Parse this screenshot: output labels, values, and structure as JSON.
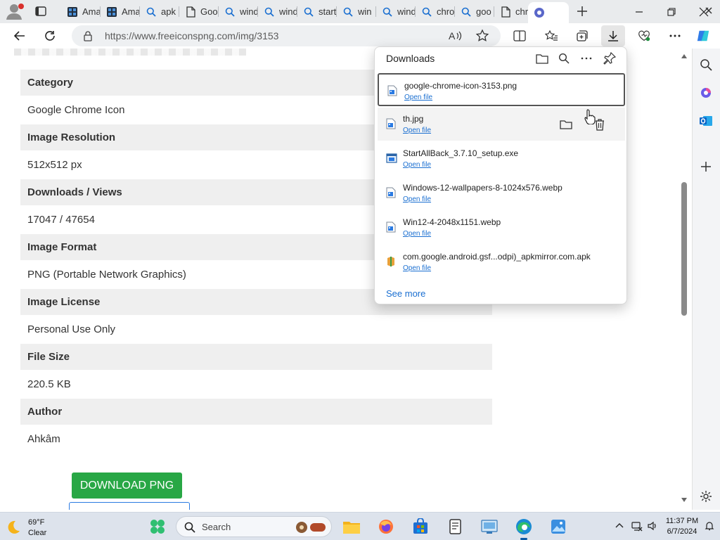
{
  "tabs": [
    {
      "label": "Ama",
      "icon": "amazon-favicon"
    },
    {
      "label": "Ama",
      "icon": "amazon-favicon"
    },
    {
      "label": "apk",
      "icon": "search-icon"
    },
    {
      "label": "Goo",
      "icon": "page-icon"
    },
    {
      "label": "wind",
      "icon": "search-icon"
    },
    {
      "label": "wind",
      "icon": "search-icon"
    },
    {
      "label": "start",
      "icon": "search-icon"
    },
    {
      "label": "win",
      "icon": "search-icon"
    },
    {
      "label": "wind",
      "icon": "search-icon"
    },
    {
      "label": "chro",
      "icon": "search-icon"
    },
    {
      "label": "goo",
      "icon": "search-icon"
    },
    {
      "label": "chro",
      "icon": "page-icon"
    }
  ],
  "address": {
    "url": "https://www.freeiconspng.com/img/3153"
  },
  "details": [
    {
      "heading": "Category",
      "value": "Google Chrome Icon"
    },
    {
      "heading": "Image Resolution",
      "value": "512x512 px"
    },
    {
      "heading": "Downloads / Views",
      "value": "17047 / 47654"
    },
    {
      "heading": "Image Format",
      "value": "PNG (Portable Network Graphics)"
    },
    {
      "heading": "Image License",
      "value": "Personal Use Only"
    },
    {
      "heading": "File Size",
      "value": "220.5 KB"
    },
    {
      "heading": "Author",
      "value": "Ahkâm"
    }
  ],
  "download_button": "DOWNLOAD PNG",
  "downloads_panel": {
    "title": "Downloads",
    "open_label": "Open file",
    "items": [
      {
        "name": "google-chrome-icon-3153.png",
        "type": "image"
      },
      {
        "name": "th.jpg",
        "type": "image"
      },
      {
        "name": "StartAllBack_3.7.10_setup.exe",
        "type": "exe"
      },
      {
        "name": "Windows-12-wallpapers-8-1024x576.webp",
        "type": "image"
      },
      {
        "name": "Win12-4-2048x1151.webp",
        "type": "image"
      },
      {
        "name": "com.google.android.gsf...odpi)_apkmirror.com.apk",
        "type": "apk"
      }
    ],
    "see_more": "See more"
  },
  "taskbar": {
    "weather_temp": "69°F",
    "weather_cond": "Clear",
    "search_placeholder": "Search",
    "time": "11:37 PM",
    "date": "6/7/2024"
  },
  "colors": {
    "download_green": "#28a745",
    "link_blue": "#1a6fd1",
    "edge_accent": "#0c59a4"
  }
}
